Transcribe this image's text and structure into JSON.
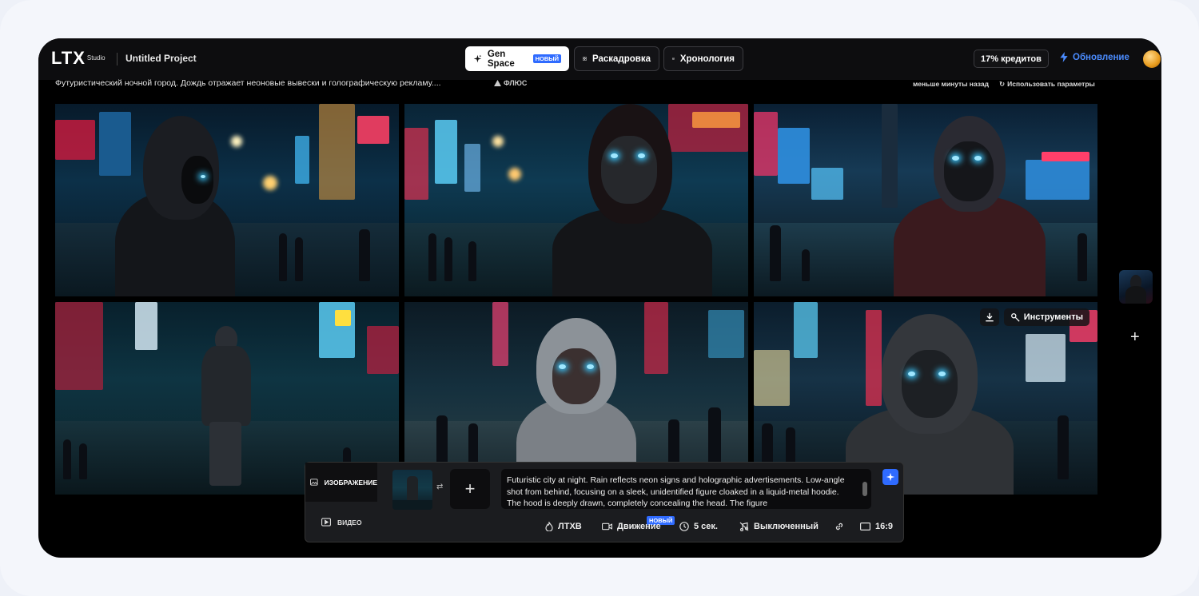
{
  "header": {
    "logo": "LTX",
    "logo_sub": "Studio",
    "project_title": "Untitled Project",
    "tabs": [
      {
        "label": "Gen Space",
        "badge": "НОВЫЙ",
        "icon": "sparkle-icon"
      },
      {
        "label": "Раскадровка",
        "icon": "grid-icon"
      },
      {
        "label": "Хронология",
        "icon": "timeline-icon"
      }
    ],
    "credits": "17% кредитов",
    "upgrade": "Обновление",
    "accent": "#2f6bff"
  },
  "generation": {
    "prompt_preview": "Футуристический ночной город. Дождь отражает неоновые вывески и голографическую рекламу....",
    "model": "ФЛЮС",
    "time_ago": "меньше минуты назад",
    "use_params": "Использовать параметры"
  },
  "grid": {
    "tools_label": "Инструменты"
  },
  "panel": {
    "mode_image": "ИЗОБРАЖЕНИЕ",
    "mode_video": "ВИДЕО",
    "prompt_text": "Futuristic city at night. Rain reflects neon signs and holographic advertisements. Low-angle shot from behind, focusing on a sleek, unidentified figure cloaked in a liquid-metal hoodie. The hood is deeply drawn, completely concealing the head. The figure",
    "options": {
      "model": "ЛТХВ",
      "motion": "Движение",
      "motion_badge": "НОВЫЙ",
      "duration": "5 сек.",
      "audio": "Выключенный",
      "ratio": "16:9"
    }
  }
}
